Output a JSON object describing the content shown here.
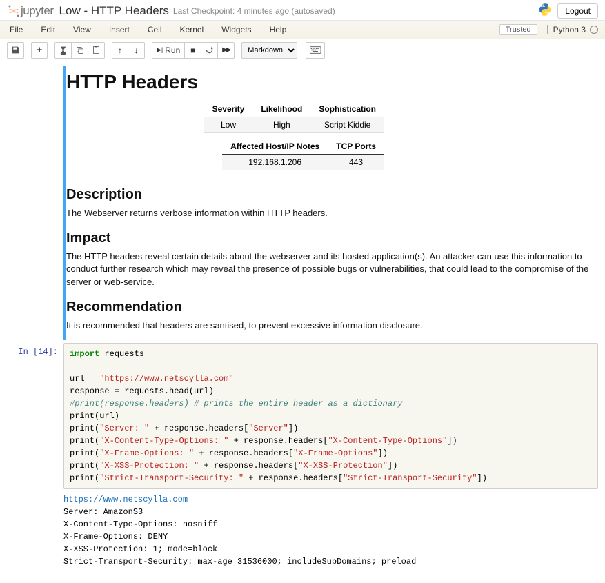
{
  "header": {
    "logo_text": "jupyter",
    "notebook_name": "Low - HTTP Headers",
    "checkpoint": "Last Checkpoint: 4 minutes ago  (autosaved)",
    "logout": "Logout"
  },
  "menubar": {
    "items": [
      "File",
      "Edit",
      "View",
      "Insert",
      "Cell",
      "Kernel",
      "Widgets",
      "Help"
    ],
    "trusted": "Trusted",
    "kernel": "Python 3"
  },
  "toolbar": {
    "save_icon": "💾",
    "add_icon": "+",
    "cut_icon": "✂",
    "copy_icon": "⧉",
    "paste_icon": "📋",
    "up_icon": "↑",
    "down_icon": "↓",
    "run_label": "Run",
    "run_icon": "▶",
    "stop_icon": "■",
    "restart_icon": "⟳",
    "ff_icon": "▶▶",
    "celltype": "Markdown",
    "cmdpal_icon": "⌨"
  },
  "md": {
    "h1": "HTTP Headers",
    "t1": {
      "h": [
        "Severity",
        "Likelihood",
        "Sophistication"
      ],
      "r": [
        "Low",
        "High",
        "Script Kiddie"
      ]
    },
    "t2": {
      "h": [
        "Affected Host/IP Notes",
        "TCP Ports"
      ],
      "r": [
        "192.168.1.206",
        "443"
      ]
    },
    "h2a": "Description",
    "pa": "The Webserver returns verbose information within HTTP headers.",
    "h2b": "Impact",
    "pb": "The HTTP headers reveal certain details about the webserver and its hosted application(s). An attacker can use this information to conduct further research which may reveal the presence of possible bugs or vulnerabilities, that could lead to the compromise of the server or web-service.",
    "h2c": "Recommendation",
    "pc": "It is recommended that headers are santised, to prevent excessive information disclosure."
  },
  "code": {
    "prompt": "In [14]:",
    "lines": {
      "l1_kw": "import",
      "l1_nm": " requests",
      "l3a": "url ",
      "l3b": "=",
      "l3c": " ",
      "l3s": "\"https://www.netscylla.com\"",
      "l4a": "response ",
      "l4b": "=",
      "l4c": " requests.head(url)",
      "l5": "#print(response.headers) # prints the entire header as a dictionary",
      "l6": "print(url)",
      "l7a": "print(",
      "l7s1": "\"Server: \"",
      "l7b": " + response.headers[",
      "l7s2": "\"Server\"",
      "l7c": "])",
      "l8a": "print(",
      "l8s1": "\"X-Content-Type-Options: \"",
      "l8b": " + response.headers[",
      "l8s2": "\"X-Content-Type-Options\"",
      "l8c": "])",
      "l9a": "print(",
      "l9s1": "\"X-Frame-Options: \"",
      "l9b": " + response.headers[",
      "l9s2": "\"X-Frame-Options\"",
      "l9c": "])",
      "l10a": "print(",
      "l10s1": "\"X-XSS-Protection: \"",
      "l10b": " + response.headers[",
      "l10s2": "\"X-XSS-Protection\"",
      "l10c": "])",
      "l11a": "print(",
      "l11s1": "\"Strict-Transport-Security: \"",
      "l11b": " + response.headers[",
      "l11s2": "\"Strict-Transport-Security\"",
      "l11c": "])"
    },
    "output": {
      "o1": "https://www.netscylla.com",
      "o2": "Server: AmazonS3",
      "o3": "X-Content-Type-Options: nosniff",
      "o4": "X-Frame-Options: DENY",
      "o5": "X-XSS-Protection: 1; mode=block",
      "o6": "Strict-Transport-Security: max-age=31536000; includeSubDomains; preload"
    }
  }
}
